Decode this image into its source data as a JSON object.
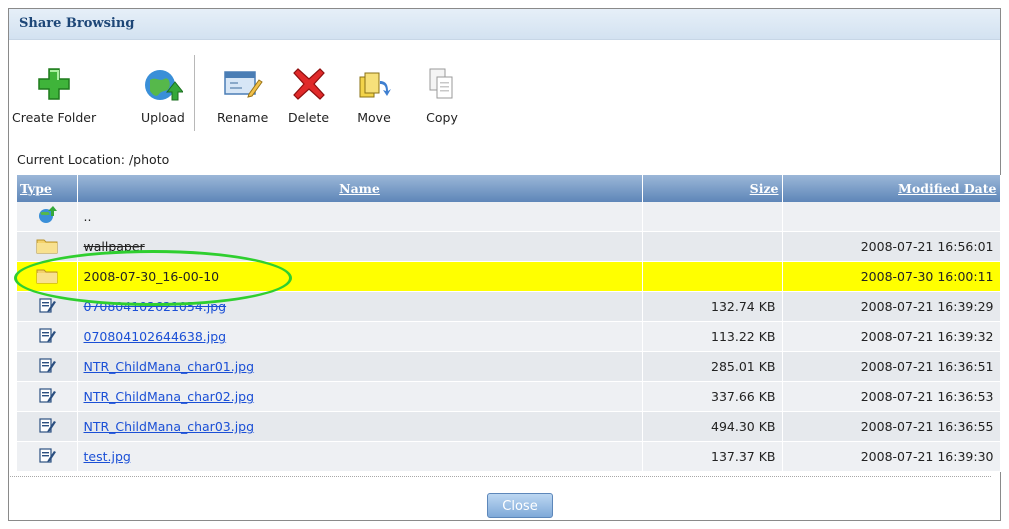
{
  "window": {
    "title": "Share Browsing"
  },
  "toolbar": {
    "buttons": [
      {
        "label": "Create Folder",
        "icon": "green-plus-icon"
      },
      {
        "label": "Upload",
        "icon": "globe-arrow-icon"
      },
      {
        "label": "Rename",
        "icon": "rename-window-icon"
      },
      {
        "label": "Delete",
        "icon": "red-x-icon"
      },
      {
        "label": "Move",
        "icon": "move-docs-icon"
      },
      {
        "label": "Copy",
        "icon": "copy-docs-icon"
      }
    ]
  },
  "location": {
    "text": "Current Location: /photo"
  },
  "table": {
    "headers": {
      "type": "Type",
      "name": "Name",
      "size": "Size",
      "modified": "Modified Date"
    },
    "rows": [
      {
        "icon": "parent-folder-icon",
        "name": "..",
        "size": "",
        "modified": ""
      },
      {
        "icon": "folder-icon",
        "name": "wallpaper",
        "size": "",
        "modified": "2008-07-21 16:56:01"
      },
      {
        "icon": "folder-icon",
        "name": "2008-07-30_16-00-10",
        "size": "",
        "modified": "2008-07-30 16:00:11",
        "selected": true
      },
      {
        "icon": "file-icon",
        "name": "070804102621054.jpg",
        "size": "132.74 KB",
        "modified": "2008-07-21 16:39:29"
      },
      {
        "icon": "file-icon",
        "name": "070804102644638.jpg",
        "size": "113.22 KB",
        "modified": "2008-07-21 16:39:32"
      },
      {
        "icon": "file-icon",
        "name": "NTR_ChildMana_char01.jpg",
        "size": "285.01 KB",
        "modified": "2008-07-21 16:36:51"
      },
      {
        "icon": "file-icon",
        "name": "NTR_ChildMana_char02.jpg",
        "size": "337.66 KB",
        "modified": "2008-07-21 16:36:53"
      },
      {
        "icon": "file-icon",
        "name": "NTR_ChildMana_char03.jpg",
        "size": "494.30 KB",
        "modified": "2008-07-21 16:36:55"
      },
      {
        "icon": "file-icon",
        "name": "test.jpg",
        "size": "137.37 KB",
        "modified": "2008-07-21 16:39:30"
      }
    ]
  },
  "footer": {
    "close_label": "Close"
  },
  "colors": {
    "highlight": "#ffff00",
    "annotation": "#2fcf2f",
    "header": "#5e86b8",
    "link": "#1a4fd6"
  }
}
